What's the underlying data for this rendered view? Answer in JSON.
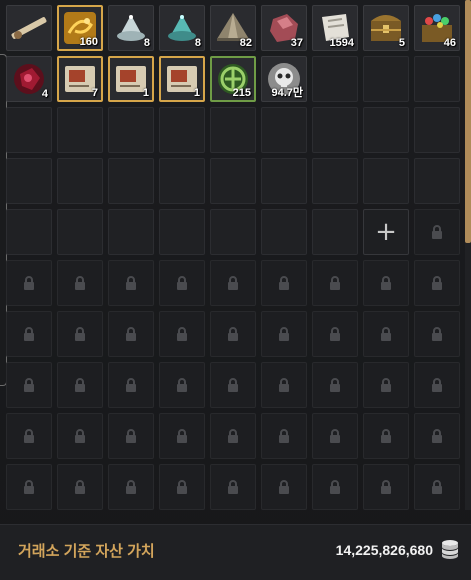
{
  "inventory": {
    "filled_slots": [
      {
        "name": "slot-long-rifle",
        "icon": "rifle-icon",
        "qty": "",
        "state": "normal"
      },
      {
        "name": "slot-golden-scroll",
        "icon": "gold-scroll-icon",
        "qty": "160",
        "state": "selected"
      },
      {
        "name": "slot-silver-lamp",
        "icon": "silver-lamp-icon",
        "qty": "8",
        "state": "normal"
      },
      {
        "name": "slot-teal-lamp",
        "icon": "teal-lamp-icon",
        "qty": "8",
        "state": "normal"
      },
      {
        "name": "slot-tent",
        "icon": "tent-icon",
        "qty": "82",
        "state": "normal"
      },
      {
        "name": "slot-red-ore",
        "icon": "red-ore-icon",
        "qty": "37",
        "state": "normal"
      },
      {
        "name": "slot-white-cloth",
        "icon": "cloth-icon",
        "qty": "1594",
        "state": "normal"
      },
      {
        "name": "slot-treasure-chest",
        "icon": "treasure-chest-icon",
        "qty": "5",
        "state": "normal"
      },
      {
        "name": "slot-gem-chest",
        "icon": "gem-chest-icon",
        "qty": "46",
        "state": "normal"
      },
      {
        "name": "slot-crimson-stone",
        "icon": "crimson-stone-icon",
        "qty": "4",
        "state": "normal"
      },
      {
        "name": "slot-flag-scroll-1",
        "icon": "flag-scroll-icon",
        "qty": "7",
        "state": "selected"
      },
      {
        "name": "slot-flag-scroll-2",
        "icon": "flag-scroll-icon",
        "qty": "1",
        "state": "selected"
      },
      {
        "name": "slot-flag-scroll-3",
        "icon": "flag-scroll-icon",
        "qty": "1",
        "state": "selected"
      },
      {
        "name": "slot-green-emblem",
        "icon": "green-emblem-icon",
        "qty": "215",
        "state": "green"
      },
      {
        "name": "slot-skull-coin",
        "icon": "skull-coin-icon",
        "qty": "94.7만",
        "state": "normal"
      }
    ],
    "empty_unlocked_count": 28,
    "add_slot_icon": "plus-icon",
    "locked_count": 46,
    "lock_icon": "lock-icon"
  },
  "footer": {
    "label": "거래소 기준 자산 가치",
    "value": "14,225,826,680",
    "icon": "silver-coin-stack-icon"
  },
  "colors": {
    "accent_gold": "#d3a55c",
    "selected_border": "#d6a64a",
    "green_border": "#6f9c46",
    "scroll_thumb": "#b08c5a"
  }
}
